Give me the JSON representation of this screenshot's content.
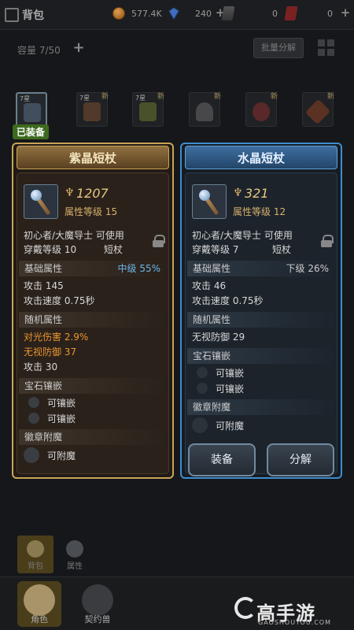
{
  "topbar": {
    "title": "背包",
    "coins": "577.4K",
    "gems": "240",
    "potions": "0",
    "cards": "0"
  },
  "bag": {
    "capacity": "容量 7/50",
    "batch_label": "批量分解",
    "equipped_tag": "已装备",
    "new_badge": "新",
    "slots": [
      {
        "quality": "7星",
        "new": false
      },
      {
        "quality": "7星",
        "new": true
      },
      {
        "quality": "7星",
        "new": true
      },
      {
        "quality": "",
        "new": true
      },
      {
        "quality": "",
        "new": true
      },
      {
        "quality": "",
        "new": true
      }
    ]
  },
  "left_card": {
    "name": "紫晶短杖",
    "power": "1207",
    "level": "属性等级 15",
    "usable": "初心者/大魔导士 可使用",
    "wear": "穿戴等级 10",
    "type": "短杖",
    "base_header": "基础属性",
    "base_grade": "中级 55%",
    "attack": "攻击 145",
    "speed": "攻击速度 0.75秒",
    "random_header": "随机属性",
    "random1": "对光伤害  2.9%",
    "random2": "无视防御  37",
    "random3": "攻击  30",
    "gem_header": "宝石镶嵌",
    "gem1": "可镶嵌",
    "gem2": "可镶嵌",
    "badge_header": "徽章附魔",
    "badge1": "可附魔"
  },
  "right_card": {
    "name": "水晶短杖",
    "power": "321",
    "level": "属性等级 12",
    "usable": "初心者/大魔导士 可使用",
    "wear": "穿戴等级 7",
    "type": "短杖",
    "base_header": "基础属性",
    "base_grade": "下级 26%",
    "attack": "攻击 46",
    "speed": "攻击速度 0.75秒",
    "random_header": "随机属性",
    "random1": "无视防御  29",
    "gem_header": "宝石镶嵌",
    "gem1": "可镶嵌",
    "gem2": "可镶嵌",
    "badge_header": "徽章附魔",
    "badge1": "可附魔",
    "equip_label": "装备",
    "decompose_label": "分解"
  },
  "bottom": {
    "tab_bag": "背包",
    "tab_attr": "属性",
    "tab_role": "角色",
    "tab_pet": "契约兽"
  },
  "watermark": {
    "text": "高手游",
    "url": "GAOSHOUYOU.COM"
  }
}
